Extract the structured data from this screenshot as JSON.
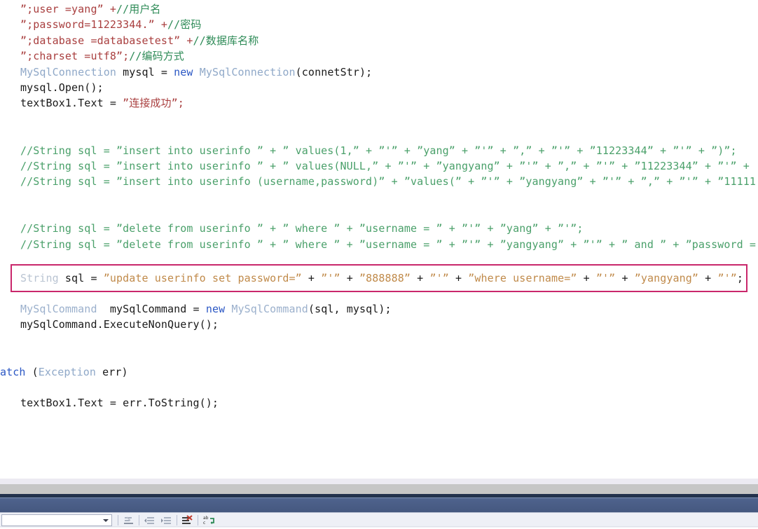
{
  "window": {
    "app_kind": "code-editor",
    "accent_highlight_color": "#c9276b",
    "titlebar_color": "#4c608a"
  },
  "editor": {
    "language": "csharp",
    "lines": [
      {
        "id": "line-conn-user",
        "indent": true,
        "segments": [
          {
            "text": "”;user =yang” +",
            "cls": "tok-str"
          },
          {
            "text": "//用户名",
            "cls": "tok-cmt"
          }
        ]
      },
      {
        "id": "line-conn-password",
        "indent": true,
        "segments": [
          {
            "text": "”;password=11223344.” +",
            "cls": "tok-str"
          },
          {
            "text": "//密码",
            "cls": "tok-cmt"
          }
        ]
      },
      {
        "id": "line-conn-database",
        "indent": true,
        "segments": [
          {
            "text": "”;database =databasetest” +",
            "cls": "tok-str"
          },
          {
            "text": "//数据库名称",
            "cls": "tok-cmt"
          }
        ]
      },
      {
        "id": "line-conn-charset",
        "indent": true,
        "segments": [
          {
            "text": "”;charset =utf8”;",
            "cls": "tok-str"
          },
          {
            "text": "//编码方式",
            "cls": "tok-cmt"
          }
        ]
      },
      {
        "id": "line-new-connection",
        "indent": true,
        "segments": [
          {
            "text": "MySqlConnection",
            "cls": "tok-type"
          },
          {
            "text": " mysql = ",
            "cls": "tok-plain"
          },
          {
            "text": "new",
            "cls": "tok-kw"
          },
          {
            "text": " ",
            "cls": "tok-plain"
          },
          {
            "text": "MySqlConnection",
            "cls": "tok-type"
          },
          {
            "text": "(connetStr);",
            "cls": "tok-plain"
          }
        ]
      },
      {
        "id": "line-open",
        "indent": true,
        "segments": [
          {
            "text": "mysql.Open();",
            "cls": "tok-plain"
          }
        ]
      },
      {
        "id": "line-textbox-success",
        "indent": true,
        "segments": [
          {
            "text": "textBox1.Text = ",
            "cls": "tok-plain"
          },
          {
            "text": "”连接成功”;",
            "cls": "tok-str"
          }
        ]
      },
      {
        "id": "line-blank-1",
        "indent": true,
        "blank": true,
        "segments": [
          {
            "text": " ",
            "cls": "tok-plain"
          }
        ]
      },
      {
        "id": "line-blank-2",
        "indent": true,
        "blank": true,
        "segments": [
          {
            "text": " ",
            "cls": "tok-plain"
          }
        ]
      },
      {
        "id": "line-comment-insert-1",
        "indent": true,
        "segments": [
          {
            "text": "//String sql = ”insert into userinfo ” + ” values(1,” + ”'” + ”yang” + ”'” + ”,” + ”'” + ”11223344” + ”'” + ”)”;",
            "cls": "tok-cmt2"
          }
        ]
      },
      {
        "id": "line-comment-insert-2",
        "indent": true,
        "segments": [
          {
            "text": "//String sql = ”insert into userinfo ” + ” values(NULL,” + ”'” + ”yangyang” + ”'” + ”,” + ”'” + ”11223344” + ”'” +",
            "cls": "tok-cmt2"
          }
        ]
      },
      {
        "id": "line-comment-insert-3",
        "indent": true,
        "segments": [
          {
            "text": "//String sql = ”insert into userinfo (username,password)” + ”values(” + ”'” + ”yangyang” + ”'” + ”,” + ”'” + ”11111",
            "cls": "tok-cmt2"
          }
        ]
      },
      {
        "id": "line-blank-3",
        "indent": true,
        "blank": true,
        "segments": [
          {
            "text": " ",
            "cls": "tok-plain"
          }
        ]
      },
      {
        "id": "line-blank-4",
        "indent": true,
        "blank": true,
        "segments": [
          {
            "text": " ",
            "cls": "tok-plain"
          }
        ]
      },
      {
        "id": "line-comment-delete-1",
        "indent": true,
        "segments": [
          {
            "text": "//String sql = ”delete from userinfo ” + ” where ” + ”username = ” + ”'” + ”yang” + ”'”;",
            "cls": "tok-cmt2"
          }
        ]
      },
      {
        "id": "line-comment-delete-2",
        "indent": true,
        "segments": [
          {
            "text": "//String sql = ”delete from userinfo ” + ” where ” + ”username = ” + ”'” + ”yangyang” + ”'” + ” and ” + ”password =",
            "cls": "tok-cmt2"
          }
        ]
      }
    ],
    "highlighted_line": {
      "id": "line-update-sql",
      "boxed": true,
      "segments": [
        {
          "text": "String",
          "cls": "tok-dim"
        },
        {
          "text": " sql = ",
          "cls": "tok-plain"
        },
        {
          "text": "”update userinfo set password=”",
          "cls": "tok-strq"
        },
        {
          "text": " + ",
          "cls": "tok-plain"
        },
        {
          "text": "”'”",
          "cls": "tok-strq"
        },
        {
          "text": " + ",
          "cls": "tok-plain"
        },
        {
          "text": "”888888”",
          "cls": "tok-strq"
        },
        {
          "text": " + ",
          "cls": "tok-plain"
        },
        {
          "text": "”'”",
          "cls": "tok-strq"
        },
        {
          "text": " + ",
          "cls": "tok-plain"
        },
        {
          "text": "”where username=”",
          "cls": "tok-strq"
        },
        {
          "text": " + ",
          "cls": "tok-plain"
        },
        {
          "text": "”'”",
          "cls": "tok-strq"
        },
        {
          "text": " + ",
          "cls": "tok-plain"
        },
        {
          "text": "”yangyang”",
          "cls": "tok-strq"
        },
        {
          "text": " + ",
          "cls": "tok-plain"
        },
        {
          "text": "”'”",
          "cls": "tok-strq"
        },
        {
          "text": ";",
          "cls": "tok-plain"
        }
      ]
    },
    "lines_after": [
      {
        "id": "line-new-command",
        "indent": true,
        "segments": [
          {
            "text": "MySqlCommand",
            "cls": "tok-type2"
          },
          {
            "text": "  mySqlCommand = ",
            "cls": "tok-plain"
          },
          {
            "text": "new",
            "cls": "tok-kw"
          },
          {
            "text": " ",
            "cls": "tok-plain"
          },
          {
            "text": "MySqlCommand",
            "cls": "tok-type2"
          },
          {
            "text": "(sql, mysql);",
            "cls": "tok-plain"
          }
        ]
      },
      {
        "id": "line-execute-nonquery",
        "indent": true,
        "segments": [
          {
            "text": "mySqlCommand.ExecuteNonQuery();",
            "cls": "tok-plain"
          }
        ]
      },
      {
        "id": "line-blank-5",
        "indent": true,
        "blank": true,
        "segments": [
          {
            "text": " ",
            "cls": "tok-plain"
          }
        ]
      },
      {
        "id": "line-blank-6",
        "indent": true,
        "blank": true,
        "segments": [
          {
            "text": " ",
            "cls": "tok-plain"
          }
        ]
      },
      {
        "id": "line-catch",
        "indent": false,
        "segments": [
          {
            "text": "atch",
            "cls": "tok-kw"
          },
          {
            "text": " (",
            "cls": "tok-plain"
          },
          {
            "text": "Exception",
            "cls": "tok-type"
          },
          {
            "text": " err)",
            "cls": "tok-plain"
          }
        ]
      },
      {
        "id": "line-blank-7",
        "indent": false,
        "blank": true,
        "segments": [
          {
            "text": " ",
            "cls": "tok-plain"
          }
        ]
      },
      {
        "id": "line-textbox-error",
        "indent": true,
        "segments": [
          {
            "text": "textBox1.Text = err.ToString();",
            "cls": "tok-plain"
          }
        ]
      }
    ]
  },
  "toolbar": {
    "combo_value": "",
    "combo_placeholder": "",
    "buttons": [
      {
        "id": "tb-comment-selection",
        "name": "comment-selection-icon",
        "label": ""
      },
      {
        "id": "tb-decrease-indent",
        "name": "decrease-indent-icon",
        "label": ""
      },
      {
        "id": "tb-increase-indent",
        "name": "increase-indent-icon",
        "label": ""
      },
      {
        "id": "tb-clear-bookmarks",
        "name": "clear-bookmarks-icon",
        "label": ""
      },
      {
        "id": "tb-find-replace",
        "name": "find-replace-abc-icon",
        "label": ""
      }
    ]
  }
}
